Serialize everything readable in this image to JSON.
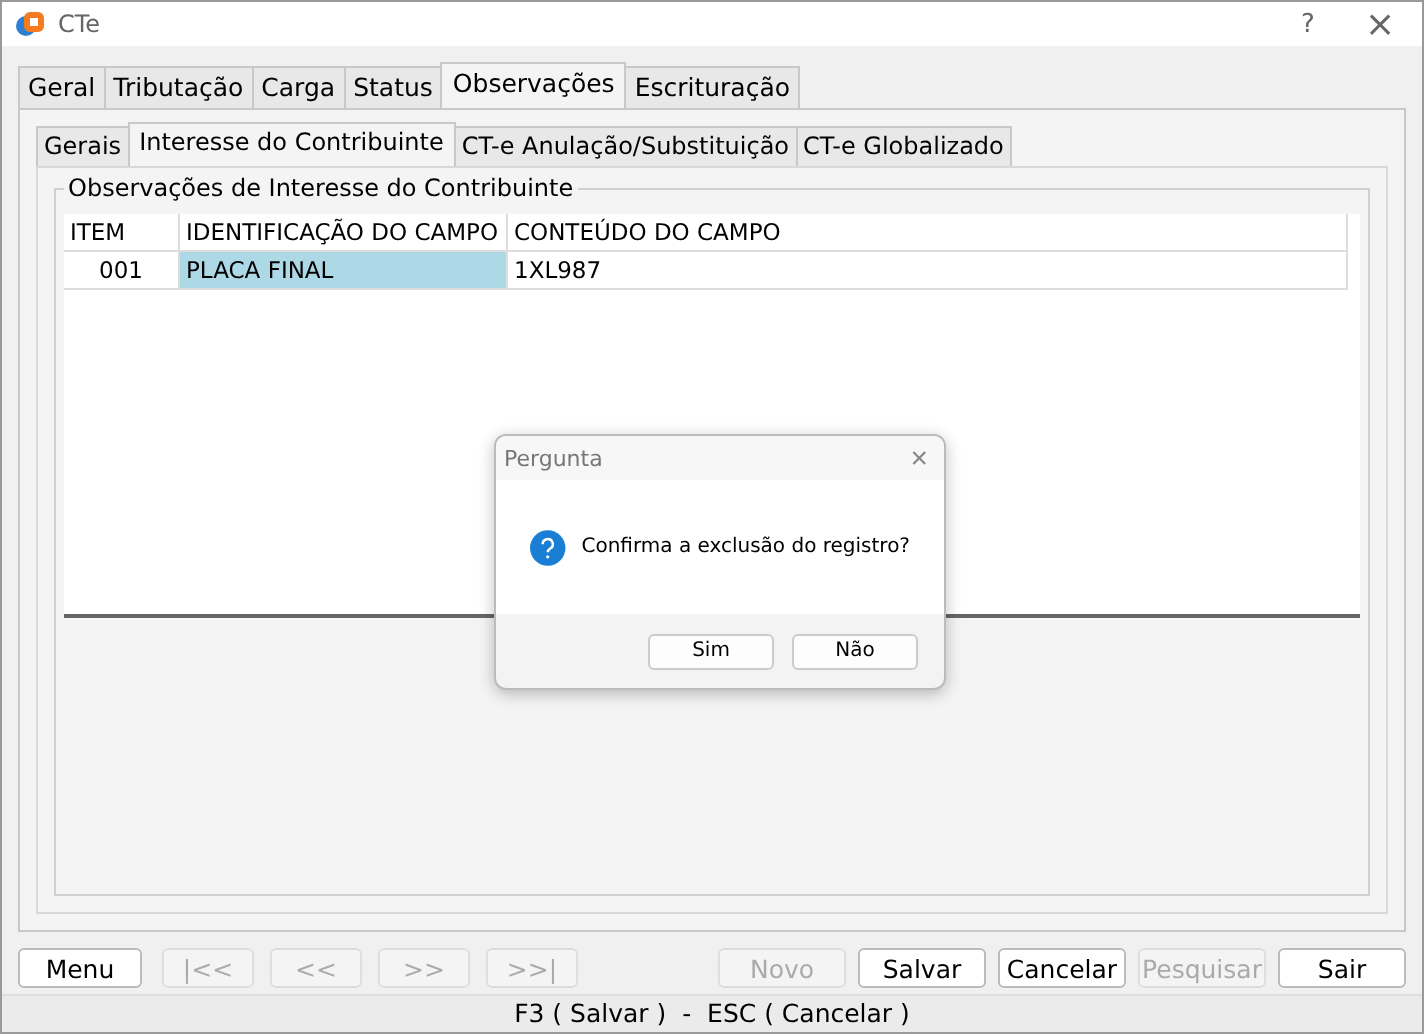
{
  "window": {
    "title": "CTe",
    "help": "?",
    "close": "×"
  },
  "tabs": [
    {
      "label": "Geral",
      "selected": false
    },
    {
      "label": "Tributação",
      "selected": false
    },
    {
      "label": "Carga",
      "selected": false
    },
    {
      "label": "Status",
      "selected": false
    },
    {
      "label": "Observações",
      "selected": true
    },
    {
      "label": "Escrituração",
      "selected": false
    }
  ],
  "subtabs": [
    {
      "label": "Gerais",
      "selected": false
    },
    {
      "label": "Interesse do Contribuinte",
      "selected": true
    },
    {
      "label": "CT-e Anulação/Substituição",
      "selected": false
    },
    {
      "label": "CT-e Globalizado",
      "selected": false
    }
  ],
  "group": {
    "title": "Observações de Interesse do Contribuinte"
  },
  "table": {
    "columns": [
      "ITEM",
      "IDENTIFICAÇÃO DO CAMPO",
      "CONTEÚDO DO CAMPO"
    ],
    "rows": [
      {
        "cells": [
          {
            "text": "001",
            "selected": false
          },
          {
            "text": "PLACA FINAL",
            "selected": true
          },
          {
            "text": "1XL987",
            "selected": false
          }
        ]
      }
    ]
  },
  "dialog": {
    "title": "Pergunta",
    "close": "×",
    "message": "Confirma a exclusão do registro?",
    "buttons": [
      "Sim",
      "Não"
    ]
  },
  "left_buttons": [
    {
      "label": "Menu",
      "disabled": false
    },
    {
      "label": "|<<",
      "disabled": true
    },
    {
      "label": "<<",
      "disabled": true
    },
    {
      "label": ">>",
      "disabled": true
    },
    {
      "label": ">>|",
      "disabled": true
    }
  ],
  "right_buttons": [
    {
      "label": "Novo",
      "disabled": true
    },
    {
      "label": "Salvar",
      "disabled": false
    },
    {
      "label": "Cancelar",
      "disabled": false
    },
    {
      "label": "Pesquisar",
      "disabled": true
    },
    {
      "label": "Sair",
      "disabled": false
    }
  ],
  "status_bar": "F3 ( Salvar )  -  ESC ( Cancelar )"
}
